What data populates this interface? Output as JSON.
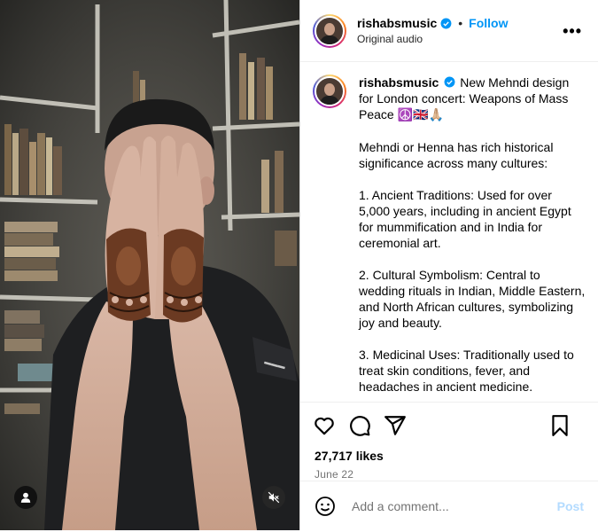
{
  "header": {
    "username": "rishabsmusic",
    "separator": "•",
    "follow_label": "Follow",
    "subtitle": "Original audio",
    "more_icon": "•••"
  },
  "caption": {
    "username": "rishabsmusic",
    "intro": "New Mehndi design for London concert: Weapons of Mass Peace",
    "emojis": "☮️🇬🇧🙏🏼",
    "paragraphs": [
      "Mehndi or Henna has rich historical significance across many cultures:",
      "1. Ancient Traditions: Used for over 5,000 years, including in ancient Egypt for mummification and in India for ceremonial art.",
      "2. Cultural Symbolism: Central to wedding rituals in Indian, Middle Eastern, and North African cultures, symbolizing joy and beauty.",
      "3. Medicinal Uses: Traditionally used to treat skin conditions, fever, and headaches in ancient medicine."
    ]
  },
  "stats": {
    "likes": "27,717 likes",
    "date": "June 22"
  },
  "comment": {
    "placeholder": "Add a comment...",
    "post_label": "Post"
  },
  "colors": {
    "accent": "#0095f6",
    "post_disabled": "#b3dbff",
    "muted_text": "#737373"
  },
  "icons": [
    "verified-badge-icon",
    "more-options-icon",
    "heart-icon",
    "comment-icon",
    "share-icon",
    "bookmark-icon",
    "emoji-icon",
    "user-tag-icon",
    "mute-icon"
  ]
}
